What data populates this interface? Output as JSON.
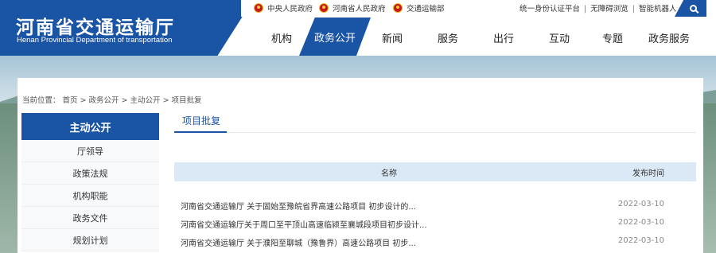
{
  "header": {
    "title": "河南省交通运输厅",
    "subtitle": "Henan Provincial Department of transportation"
  },
  "topbar": {
    "links": [
      "中央人民政府",
      "河南省人民政府",
      "交通运输部"
    ],
    "utils": [
      "统一身份认证平台",
      "无障碍浏览",
      "智能机器人"
    ],
    "separator": "|"
  },
  "nav": {
    "items": [
      "机构",
      "政务公开",
      "新闻",
      "服务",
      "出行",
      "互动",
      "专题",
      "政务服务"
    ],
    "active": "政务公开"
  },
  "breadcrumb": "当前位置： 首页 > 政务公开 > 主动公开 > 项目批复",
  "sidebar": {
    "heading": "主动公开",
    "items": [
      "厅领导",
      "政策法规",
      "机构职能",
      "政务文件",
      "规划计划"
    ]
  },
  "main": {
    "tab": "项目批复",
    "columns": {
      "name": "名称",
      "date": "发布时间"
    },
    "rows": [
      {
        "title": "河南省交通运输厅 关于固始至豫皖省界高速公路项目 初步设计的...",
        "date": "2022-03-10"
      },
      {
        "title": "河南省交通运输厅关于周口至平顶山高速临颍至襄城段项目初步设计...",
        "date": "2022-03-10"
      },
      {
        "title": "河南省交通运输厅 关于濮阳至聊城（豫鲁界）高速公路项目 初步...",
        "date": "2022-03-10"
      }
    ]
  },
  "colors": {
    "brand": "#1a54a4",
    "table_head": "#dbe9f6"
  }
}
